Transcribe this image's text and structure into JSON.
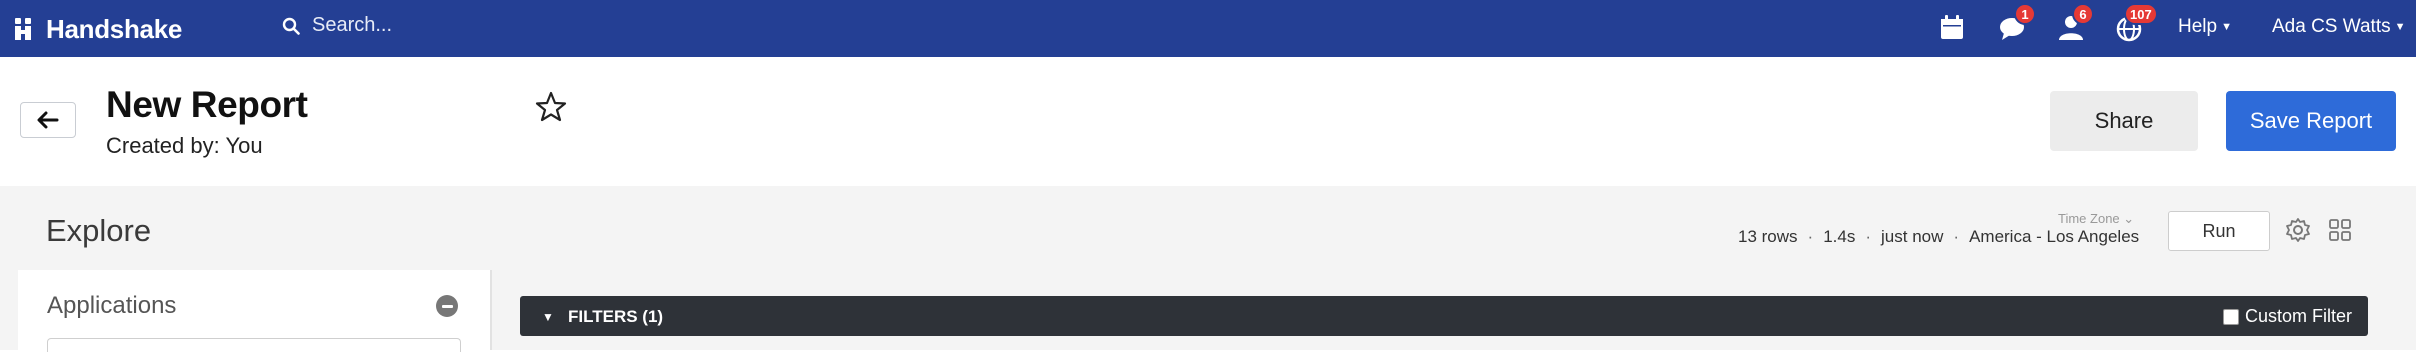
{
  "nav": {
    "logo_text": "Handshake",
    "search_placeholder": "Search...",
    "messages_badge": "1",
    "requests_badge": "6",
    "notifications_badge": "107",
    "help_label": "Help",
    "user_label": "Ada CS Watts"
  },
  "header": {
    "title": "New Report",
    "subtitle": "Created by: You",
    "share_label": "Share",
    "save_label": "Save Report"
  },
  "explore": {
    "title": "Explore",
    "section_label": "Applications"
  },
  "results": {
    "rows": "13 rows",
    "duration": "1.4s",
    "last_run": "just now",
    "timezone_caption": "Time Zone",
    "timezone": "America - Los Angeles",
    "run_label": "Run"
  },
  "filters": {
    "label": "FILTERS (1)",
    "custom_filter_label": "Custom Filter"
  },
  "colors": {
    "nav_bg": "#243f94",
    "primary": "#2e6bd9",
    "badge": "#e53935",
    "filters_bg": "#2e3238"
  }
}
